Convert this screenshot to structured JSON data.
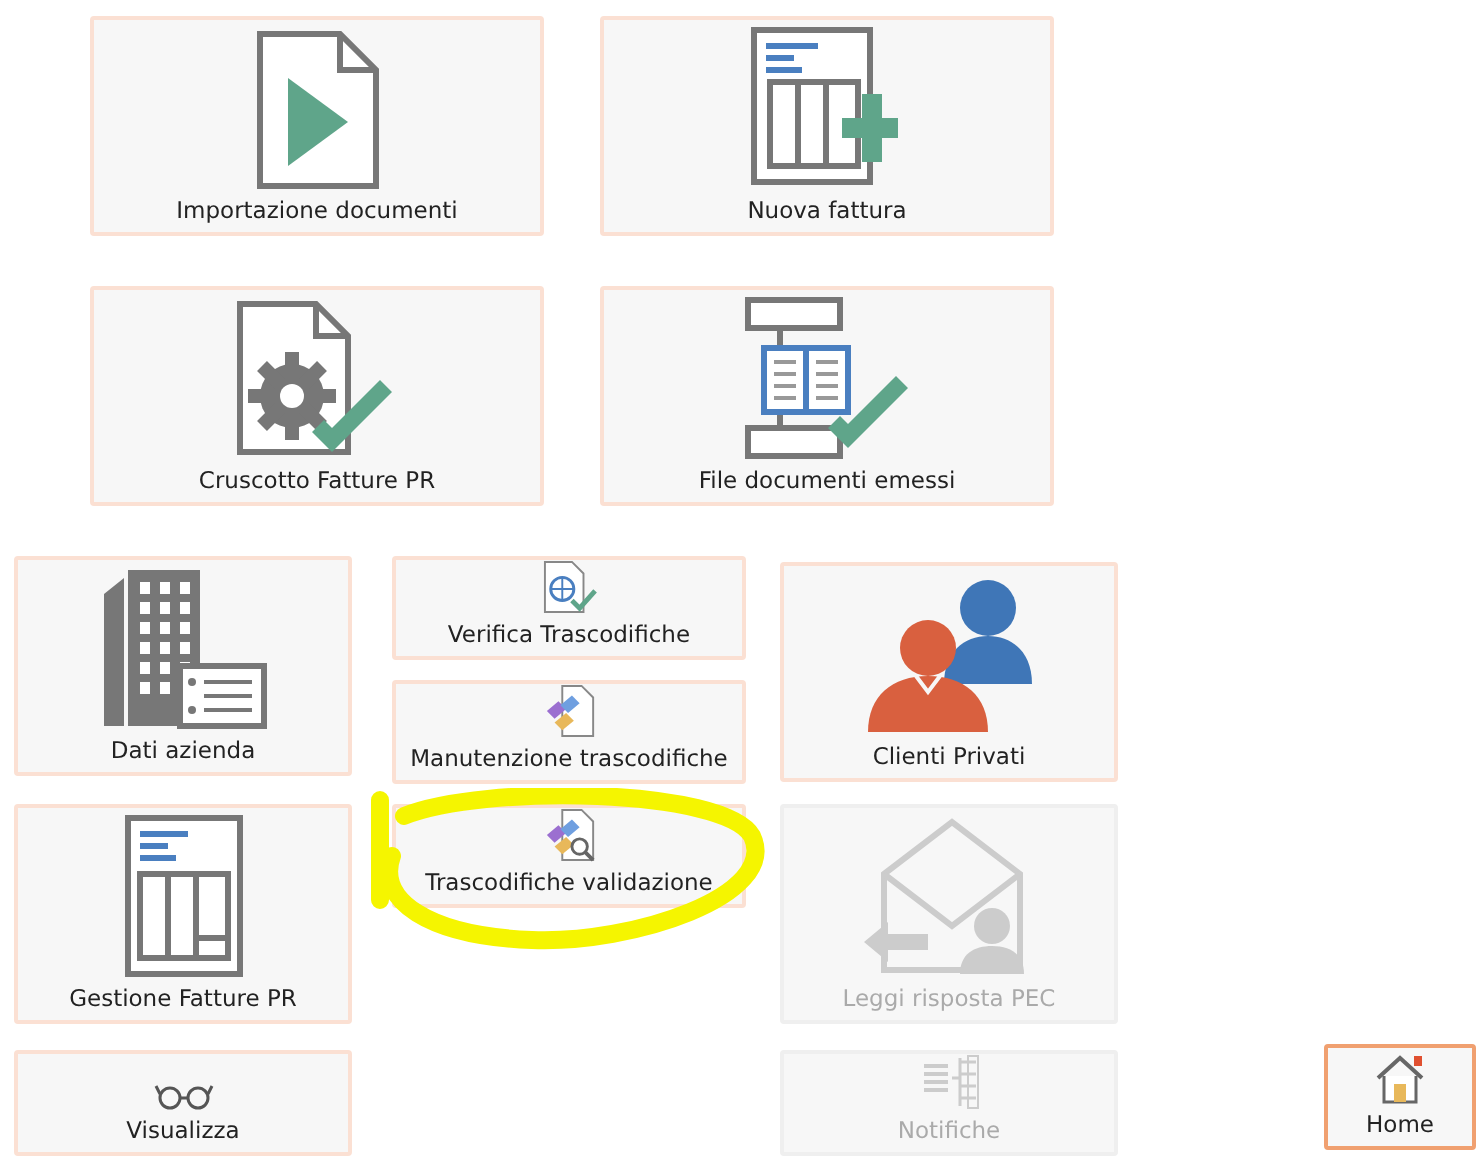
{
  "main_tiles": [
    {
      "label": "Importazione documenti",
      "kind": "import",
      "disabled": false
    },
    {
      "label": "Nuova fattura",
      "kind": "new-invoice",
      "disabled": false
    },
    {
      "label": "Cruscotto Fatture PR",
      "kind": "dashboard",
      "disabled": false
    },
    {
      "label": "File documenti emessi",
      "kind": "issued",
      "disabled": false
    }
  ],
  "column_1": [
    {
      "label": "Dati azienda",
      "kind": "company",
      "disabled": false
    },
    {
      "label": "Gestione Fatture PR",
      "kind": "invoice",
      "disabled": false
    },
    {
      "label": "Visualizza",
      "kind": "glasses",
      "disabled": false
    }
  ],
  "column_2": [
    {
      "label": "Verifica Trascodifiche",
      "kind": "verify",
      "highlighted": false,
      "disabled": false
    },
    {
      "label": "Manutenzione trascodifiche",
      "kind": "maintain",
      "highlighted": false,
      "disabled": false
    },
    {
      "label": "Trascodifiche validazione",
      "kind": "validate",
      "highlighted": true,
      "disabled": false
    }
  ],
  "column_3": [
    {
      "label": "Clienti Privati",
      "kind": "clients",
      "disabled": false
    },
    {
      "label": "Leggi risposta PEC",
      "kind": "mail",
      "disabled": true
    },
    {
      "label": "Notifiche",
      "kind": "notify",
      "disabled": true
    }
  ],
  "home": {
    "label": "Home",
    "selected": true
  }
}
